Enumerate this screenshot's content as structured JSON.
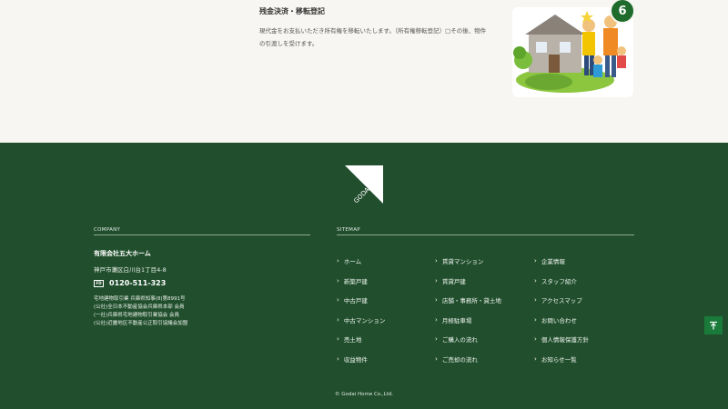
{
  "step": {
    "title": "残金決済・移転登記",
    "description": "現代金をお支払いただき所有権を移転いたします。（所有権移転登記）□その後、物件の引渡しを受けます。",
    "badge": "6"
  },
  "footer": {
    "company_heading": "COMPANY",
    "sitemap_heading": "SITEMAP",
    "company_name": "有限会社五大ホーム",
    "address": "神戸市灘区白川台1丁目4-8",
    "phone_icon": "FD",
    "phone": "0120-511-323",
    "licenses": [
      "宅地建物取引業 兵庫県知事(8)第8991号",
      "(公社)全日本不動産協会兵庫県本部 会員",
      "(一社)兵庫県宅地建物取引業協会 会員",
      "(公社)近畿地区不動産公正取引協議会加盟"
    ],
    "nav_col1": [
      "ホーム",
      "新築戸建",
      "中古戸建",
      "中古マンション",
      "売土地",
      "収益物件"
    ],
    "nav_col2": [
      "賃貸マンション",
      "賃貸戸建",
      "店舗・事務所・貸土地",
      "月極駐車場",
      "ご購入の流れ",
      "ご売却の流れ"
    ],
    "nav_col3": [
      "企業情報",
      "スタッフ紹介",
      "アクセスマップ",
      "お問い合わせ",
      "個人情報保護方針",
      "お知らせ一覧"
    ],
    "copyright": "© Godai Home Co.,Ltd.",
    "logo_text": "GODAI",
    "to_top_icon": "arrow-up-icon"
  }
}
